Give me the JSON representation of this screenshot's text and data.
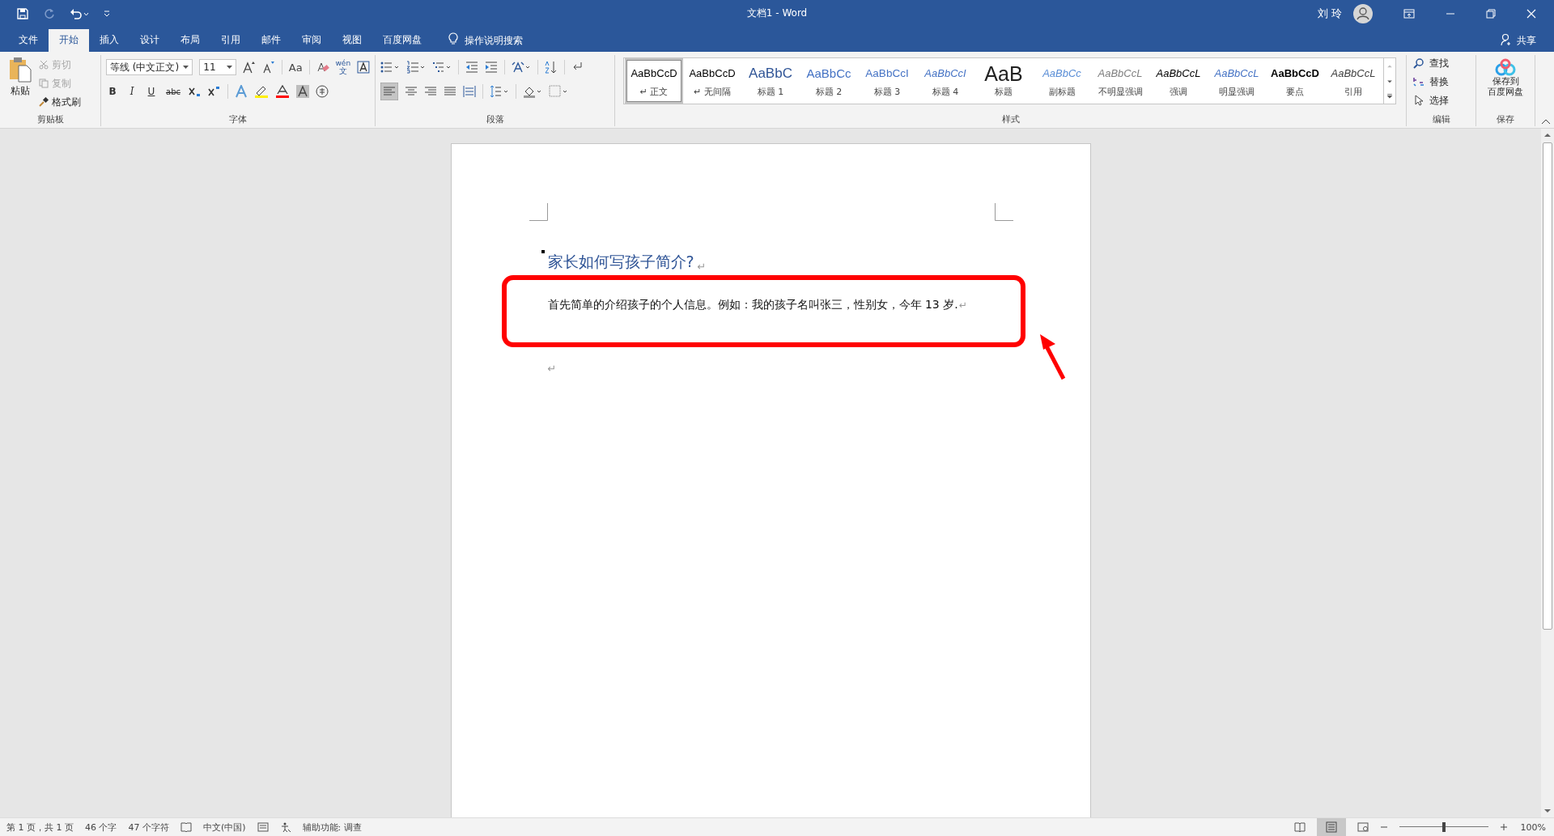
{
  "window": {
    "title": "文档1  -  Word",
    "user": "刘 玲"
  },
  "tabs": [
    {
      "label": "文件",
      "selected": false
    },
    {
      "label": "开始",
      "selected": true
    },
    {
      "label": "插入",
      "selected": false
    },
    {
      "label": "设计",
      "selected": false
    },
    {
      "label": "布局",
      "selected": false
    },
    {
      "label": "引用",
      "selected": false
    },
    {
      "label": "邮件",
      "selected": false
    },
    {
      "label": "审阅",
      "selected": false
    },
    {
      "label": "视图",
      "selected": false
    },
    {
      "label": "百度网盘",
      "selected": false
    }
  ],
  "tell_me": "操作说明搜索",
  "share": "共享",
  "clipboard": {
    "label": "剪贴板",
    "paste": "粘贴",
    "cut": {
      "label": "剪切",
      "disabled": true
    },
    "copy": {
      "label": "复制",
      "disabled": true
    },
    "format_painter": {
      "label": "格式刷",
      "disabled": false
    }
  },
  "font": {
    "label": "字体",
    "font_name": "等线 (中文正文)",
    "font_size": "11",
    "change_case": "Aa",
    "phonetic": "wén",
    "phonetic_char": "文",
    "format_buttons": [
      "B",
      "I",
      "U",
      "abc"
    ]
  },
  "paragraph": {
    "label": "段落"
  },
  "styles": {
    "label": "样式",
    "items": [
      {
        "kind": "normal",
        "preview": "AaBbCcD",
        "name": "↵ 正文",
        "selected": true
      },
      {
        "kind": "no-spacing",
        "preview": "AaBbCcD",
        "name": "↵ 无间隔",
        "selected": false
      },
      {
        "kind": "heading1",
        "preview": "AaBbC",
        "name": "标题 1",
        "selected": false
      },
      {
        "kind": "heading2",
        "preview": "AaBbCc",
        "name": "标题 2",
        "selected": false
      },
      {
        "kind": "heading3",
        "preview": "AaBbCcI",
        "name": "标题 3",
        "selected": false
      },
      {
        "kind": "heading4",
        "preview": "AaBbCcI",
        "name": "标题 4",
        "selected": false
      },
      {
        "kind": "title",
        "preview": "AaB",
        "name": "标题",
        "selected": false
      },
      {
        "kind": "subtitle",
        "preview": "AaBbCc",
        "name": "副标题",
        "selected": false
      },
      {
        "kind": "subtle-emphasis",
        "preview": "AaBbCcL",
        "name": "不明显强调",
        "selected": false
      },
      {
        "kind": "emphasis",
        "preview": "AaBbCcL",
        "name": "强调",
        "selected": false
      },
      {
        "kind": "intense-emphasis",
        "preview": "AaBbCcL",
        "name": "明显强调",
        "selected": false
      },
      {
        "kind": "strong",
        "preview": "AaBbCcD",
        "name": "要点",
        "selected": false
      },
      {
        "kind": "quote",
        "preview": "AaBbCcL",
        "name": "引用",
        "selected": false
      }
    ]
  },
  "editing": {
    "label": "编辑",
    "find": "查找",
    "replace": "替换",
    "select": "选择"
  },
  "save": {
    "label": "保存",
    "button": [
      "保存到",
      "百度网盘"
    ]
  },
  "document": {
    "heading": "家长如何写孩子简介?",
    "heading_mark": "↵",
    "paragraph": "首先简单的介绍孩子的个人信息。例如：我的孩子名叫张三，性别女，今年 13 岁.",
    "paragraph_mark": "↵",
    "empty_mark": "↵"
  },
  "status_bar": {
    "page": "第 1 页，共 1 页",
    "words": "46 个字",
    "chars": "47 个字符",
    "language": "中文(中国)",
    "accessibility": "辅助功能: 调查",
    "zoom": "100%",
    "zoom_slider": {
      "level": 0.5
    }
  }
}
